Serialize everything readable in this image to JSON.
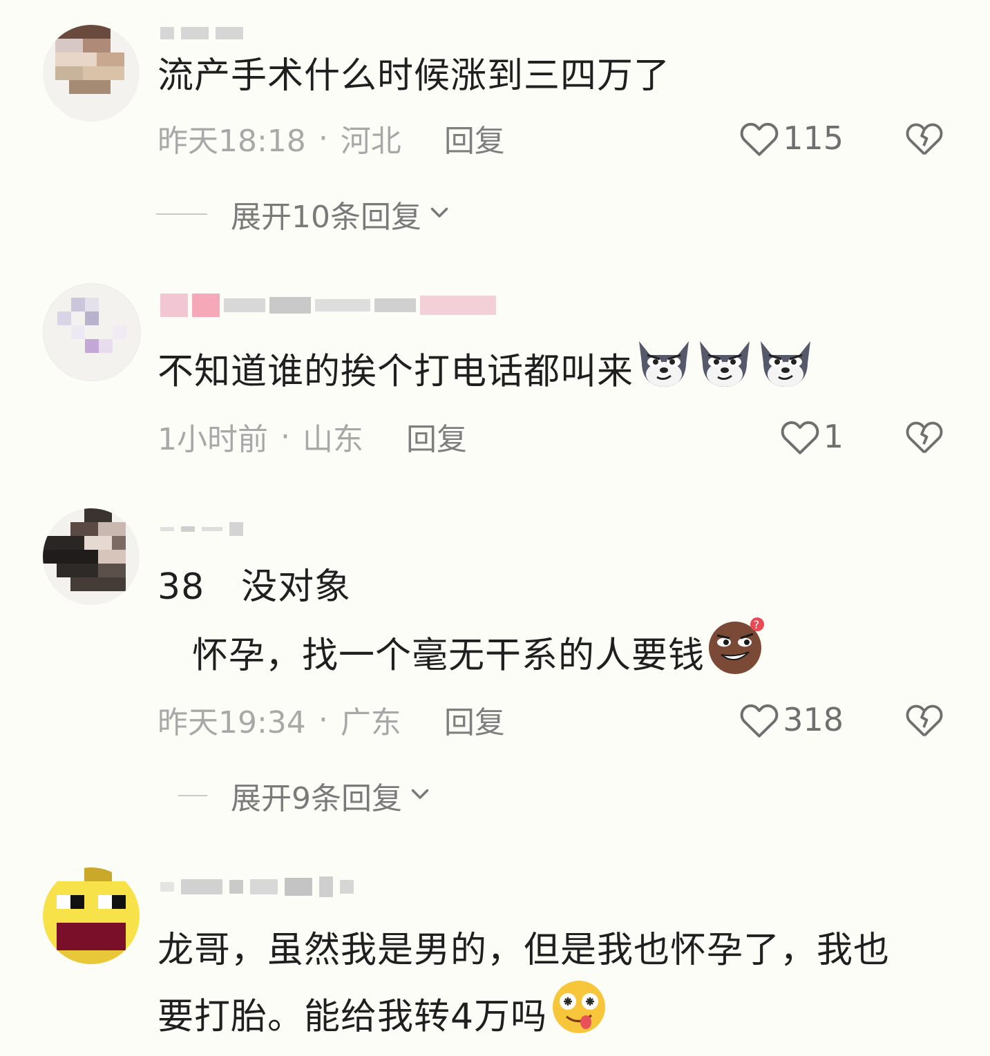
{
  "comments": [
    {
      "text": "流产手术什么时候涨到三四万了",
      "time": "昨天18:18",
      "location": "河北",
      "reply_label": "回复",
      "likes": "115",
      "expand_label": "展开10条回复"
    },
    {
      "text": "不知道谁的挨个打电话都叫来",
      "time": "1小时前",
      "location": "山东",
      "reply_label": "回复",
      "likes": "1",
      "emojis": [
        "wolf-emoji",
        "wolf-emoji",
        "wolf-emoji"
      ]
    },
    {
      "text_line1": "38　没对象",
      "text_line2": "怀孕，找一个毫无干系的人要钱",
      "time": "昨天19:34",
      "location": "广东",
      "reply_label": "回复",
      "likes": "318",
      "expand_label": "展开9条回复",
      "emojis": [
        "smirk-emoji"
      ]
    },
    {
      "text_line1": "龙哥，虽然我是男的，但是我也怀孕了，我也",
      "text_line2": "要打胎。能给我转4万吗",
      "emojis": [
        "drool-emoji"
      ]
    }
  ],
  "separator": "·",
  "colors": {
    "background": "#fdfdf8",
    "text": "#1f1f1f",
    "meta": "#a8a8a8",
    "icon": "#6f6f6f"
  }
}
